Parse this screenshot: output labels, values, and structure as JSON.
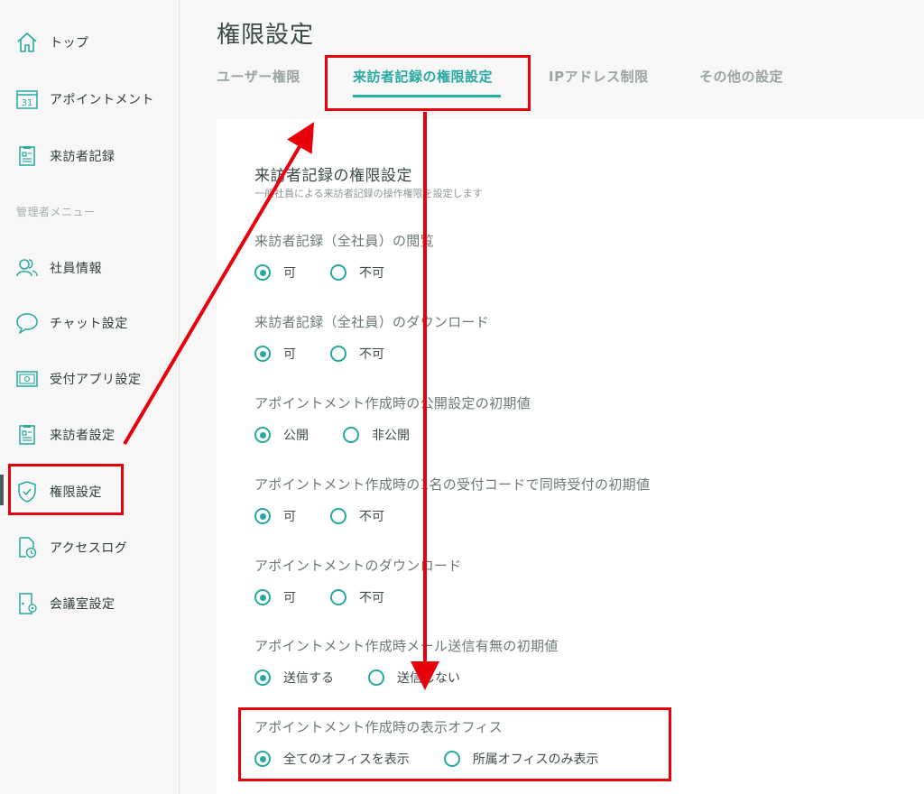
{
  "sidebar": {
    "items": [
      {
        "label": "トップ",
        "icon": "home-icon"
      },
      {
        "label": "アポイントメント",
        "icon": "calendar-icon",
        "icon_text": "31"
      },
      {
        "label": "来訪者記録",
        "icon": "clipboard-icon"
      },
      {
        "label": "社員情報",
        "icon": "users-icon"
      },
      {
        "label": "チャット設定",
        "icon": "chat-icon"
      },
      {
        "label": "受付アプリ設定",
        "icon": "tablet-icon"
      },
      {
        "label": "来訪者設定",
        "icon": "clipboard-icon"
      },
      {
        "label": "権限設定",
        "icon": "shield-icon"
      },
      {
        "label": "アクセスログ",
        "icon": "file-clock-icon"
      },
      {
        "label": "会議室設定",
        "icon": "door-icon"
      }
    ],
    "admin_section_label": "管理者メニュー",
    "active_item": "権限設定"
  },
  "page": {
    "title": "権限設定"
  },
  "tabs": [
    {
      "label": "ユーザー権限",
      "active": false
    },
    {
      "label": "来訪者記録の権限設定",
      "active": true
    },
    {
      "label": "IPアドレス制限",
      "active": false
    },
    {
      "label": "その他の設定",
      "active": false
    }
  ],
  "panel": {
    "title": "来訪者記録の権限設定",
    "description": "一般社員による来訪者記録の操作権限を設定します",
    "settings": [
      {
        "label": "来訪者記録（全社員）の閲覧",
        "options": [
          "可",
          "不可"
        ],
        "selected": 0
      },
      {
        "label": "来訪者記録（全社員）のダウンロード",
        "options": [
          "可",
          "不可"
        ],
        "selected": 0
      },
      {
        "label": "アポイントメント作成時の公開設定の初期値",
        "options": [
          "公開",
          "非公開"
        ],
        "selected": 0
      },
      {
        "label": "アポイントメント作成時の1名の受付コードで同時受付の初期値",
        "options": [
          "可",
          "不可"
        ],
        "selected": 0
      },
      {
        "label": "アポイントメントのダウンロード",
        "options": [
          "可",
          "不可"
        ],
        "selected": 0
      },
      {
        "label": "アポイントメント作成時メール送信有無の初期値",
        "options": [
          "送信する",
          "送信しない"
        ],
        "selected": 0
      },
      {
        "label": "アポイントメント作成時の表示オフィス",
        "options": [
          "全てのオフィスを表示",
          "所属オフィスのみ表示"
        ],
        "selected": 0
      }
    ]
  },
  "colors": {
    "accent": "#27a8a0",
    "annotation": "#e8000b",
    "panel_bg": "#ffffff",
    "page_bg": "#f7f7f7"
  }
}
